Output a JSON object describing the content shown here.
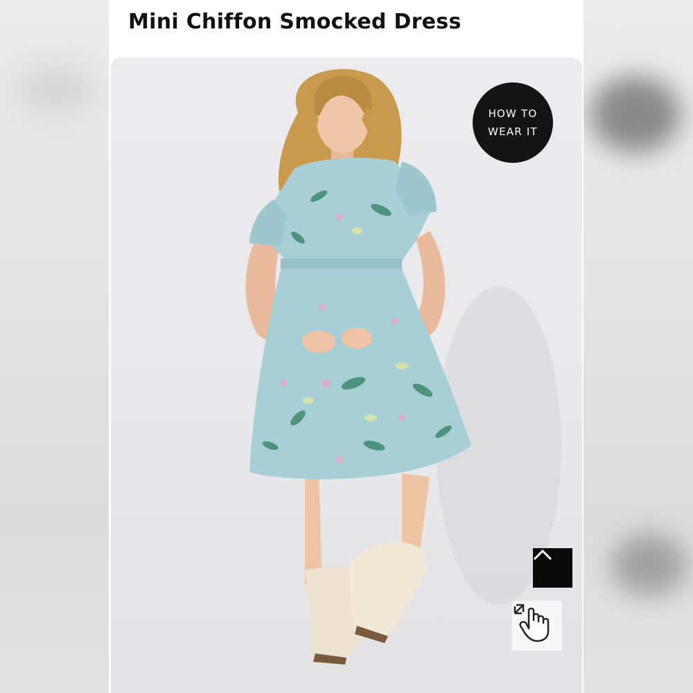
{
  "product": {
    "title": "Mini Chiffon Smocked Dress"
  },
  "overlay": {
    "how_to_wear_line1": "HOW TO",
    "how_to_wear_line2": "WEAR IT"
  },
  "icons": {
    "scroll_top": "chevron-up-icon",
    "zoom": "pinch-zoom-hand-icon"
  },
  "colors": {
    "title": "#111111",
    "badge_bg": "#141414",
    "dress": "#a9cfd6",
    "boots": "#ece2cf"
  }
}
